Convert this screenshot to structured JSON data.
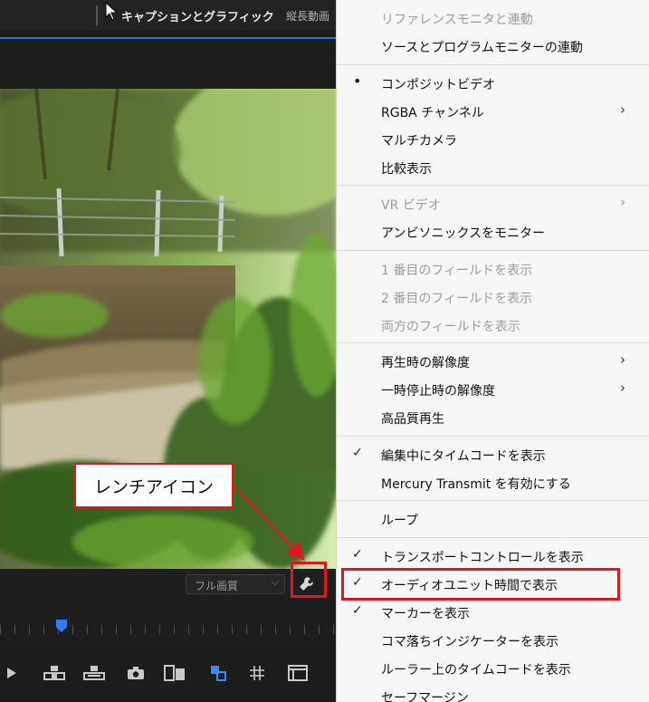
{
  "header": {
    "title": "キャプションとグラフィック",
    "subtitle": "縦長動画"
  },
  "monitor": {
    "quality": "フル画質",
    "wrench_icon": "wrench-icon",
    "transport_icons": [
      "play-icon",
      "insert-icon",
      "overwrite-icon",
      "camera-icon",
      "compare-view-icon",
      "swap-icon",
      "grid-icon",
      "film-icon"
    ]
  },
  "callout": {
    "text": "レンチアイコン",
    "color": "#e0171c"
  },
  "menu": {
    "items": [
      {
        "label": "リファレンスモニタと連動",
        "disabled": true
      },
      {
        "label": "ソースとプログラムモニターの連動"
      },
      {
        "label": "コンポジットビデオ",
        "mark": "bullet"
      },
      {
        "label": "RGBA チャンネル",
        "submenu": true
      },
      {
        "label": "マルチカメラ"
      },
      {
        "label": "比較表示"
      },
      {
        "label": "VR ビデオ",
        "disabled": true,
        "submenu": true
      },
      {
        "label": "アンビソニックスをモニター"
      },
      {
        "label": "1 番目のフィールドを表示",
        "disabled": true
      },
      {
        "label": "2 番目のフィールドを表示",
        "disabled": true
      },
      {
        "label": "両方のフィールドを表示",
        "disabled": true
      },
      {
        "label": "再生時の解像度",
        "submenu": true
      },
      {
        "label": "一時停止時の解像度",
        "submenu": true
      },
      {
        "label": "高品質再生"
      },
      {
        "label": "編集中にタイムコードを表示",
        "mark": "check"
      },
      {
        "label": "Mercury Transmit を有効にする"
      },
      {
        "label": "ループ"
      },
      {
        "label": "トランスポートコントロールを表示",
        "mark": "check"
      },
      {
        "label": "オーディオユニット時間で表示",
        "mark": "check",
        "highlighted": true
      },
      {
        "label": "マーカーを表示",
        "mark": "check"
      },
      {
        "label": "コマ落ちインジケーターを表示"
      },
      {
        "label": "ルーラー上のタイムコードを表示"
      },
      {
        "label": "セーフマージン"
      }
    ]
  }
}
